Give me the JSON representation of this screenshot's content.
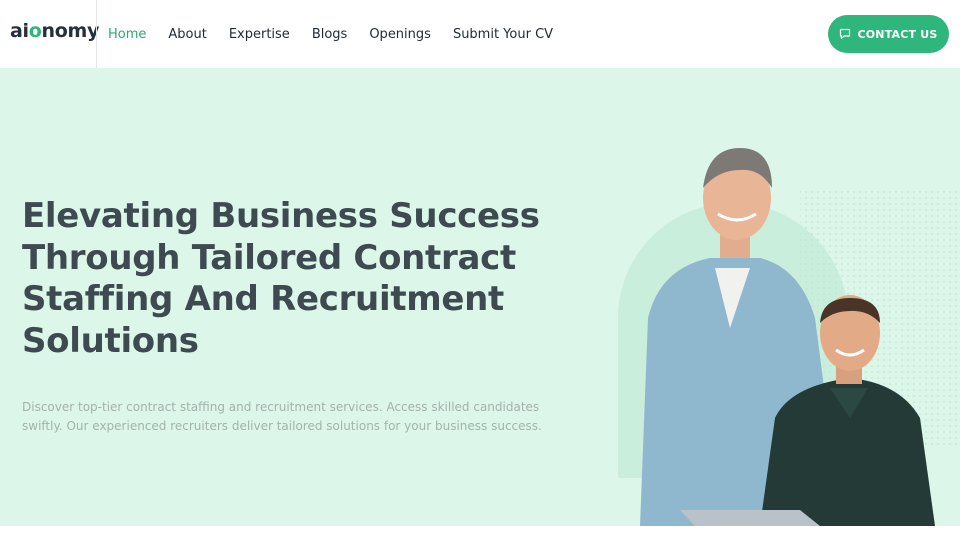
{
  "header": {
    "logo": {
      "pre": "ai",
      "accent": "o",
      "post": "nomy"
    },
    "nav": [
      {
        "label": "Home",
        "active": true
      },
      {
        "label": "About"
      },
      {
        "label": "Expertise"
      },
      {
        "label": "Blogs"
      },
      {
        "label": "Openings"
      },
      {
        "label": "Submit Your CV"
      }
    ],
    "contact_label": "CONTACT US",
    "contact_icon": "chat-icon"
  },
  "hero": {
    "title": "Elevating Business Success Through Tailored Contract Staffing And Recruitment Solutions",
    "subtitle": "Discover top-tier contract staffing and recruitment services. Access skilled candidates swiftly. Our experienced recruiters deliver tailored solutions for your business success."
  },
  "colors": {
    "accent": "#2fb67c",
    "hero_background": "#dcf7ea",
    "heading": "#3d4a4f"
  }
}
